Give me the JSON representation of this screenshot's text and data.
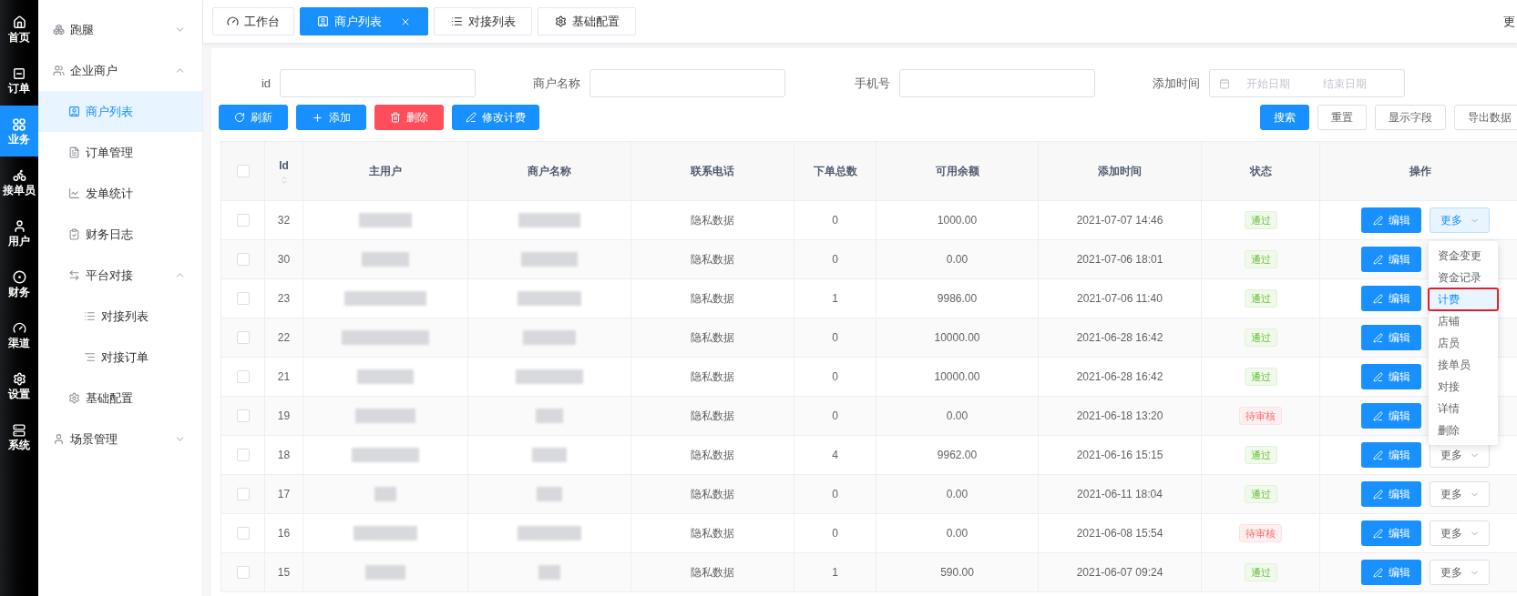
{
  "nav": [
    {
      "label": "首页",
      "selected": false
    },
    {
      "label": "订单",
      "selected": false
    },
    {
      "label": "业务",
      "selected": true
    },
    {
      "label": "接单员",
      "selected": false
    },
    {
      "label": "用户",
      "selected": false
    },
    {
      "label": "财务",
      "selected": false
    },
    {
      "label": "渠道",
      "selected": false
    },
    {
      "label": "设置",
      "selected": false
    },
    {
      "label": "系统",
      "selected": false
    }
  ],
  "submenu": [
    {
      "label": "跑腿",
      "expanded": false
    },
    {
      "label": "企业商户",
      "expanded": true,
      "children": [
        {
          "label": "商户列表",
          "selected": true
        },
        {
          "label": "订单管理",
          "selected": false
        },
        {
          "label": "发单统计",
          "selected": false
        },
        {
          "label": "财务日志",
          "selected": false
        },
        {
          "label": "平台对接",
          "expanded": true,
          "children": [
            {
              "label": "对接列表",
              "selected": false
            },
            {
              "label": "对接订单",
              "selected": false
            }
          ]
        },
        {
          "label": "基础配置",
          "selected": false
        }
      ]
    },
    {
      "label": "场景管理",
      "expanded": false
    }
  ],
  "tabs": [
    {
      "label": "工作台",
      "selected": false
    },
    {
      "label": "商户列表",
      "selected": true,
      "closable": true
    },
    {
      "label": "对接列表",
      "selected": false
    },
    {
      "label": "基础配置",
      "selected": false
    }
  ],
  "header_right_text": "更",
  "filters": [
    {
      "label": "id",
      "kind": "text"
    },
    {
      "label": "商户名称",
      "kind": "text"
    },
    {
      "label": "手机号",
      "kind": "text"
    },
    {
      "label": "添加时间",
      "kind": "daterange",
      "start_placeholder": "开始日期",
      "end_placeholder": "结束日期"
    }
  ],
  "actions": [
    {
      "label": "刷新",
      "kind": "primary"
    },
    {
      "label": "添加",
      "kind": "primary"
    },
    {
      "label": "删除",
      "kind": "danger"
    },
    {
      "label": "修改计费",
      "kind": "primary"
    }
  ],
  "search_actions": [
    {
      "label": "搜索",
      "kind": "primary"
    },
    {
      "label": "重置",
      "kind": "default"
    },
    {
      "label": "显示字段",
      "kind": "default"
    },
    {
      "label": "导出数据",
      "kind": "default"
    }
  ],
  "table": {
    "all_checked": false,
    "columns": [
      "Id",
      "主用户",
      "商户名称",
      "联系电话",
      "下单总数",
      "可用余额",
      "添加时间",
      "状态",
      "操作"
    ],
    "rows": [
      {
        "checked": false,
        "id": "32",
        "phone": "隐私数据",
        "orders": "0",
        "balance": "1000.00",
        "added": "2021-07-07 14:46",
        "status": {
          "label": "通过",
          "kind": "approved"
        },
        "edit": "编辑",
        "more": {
          "label": "更多",
          "active": true
        }
      },
      {
        "checked": false,
        "id": "30",
        "phone": "隐私数据",
        "orders": "0",
        "balance": "0.00",
        "added": "2021-07-06 18:01",
        "status": {
          "label": "通过",
          "kind": "approved"
        },
        "edit": "编辑"
      },
      {
        "checked": false,
        "id": "23",
        "phone": "隐私数据",
        "orders": "1",
        "balance": "9986.00",
        "added": "2021-07-06 11:40",
        "status": {
          "label": "通过",
          "kind": "approved"
        },
        "edit": "编辑"
      },
      {
        "checked": false,
        "id": "22",
        "phone": "隐私数据",
        "orders": "0",
        "balance": "10000.00",
        "added": "2021-06-28 16:42",
        "status": {
          "label": "通过",
          "kind": "approved"
        },
        "edit": "编辑"
      },
      {
        "checked": false,
        "id": "21",
        "phone": "隐私数据",
        "orders": "0",
        "balance": "10000.00",
        "added": "2021-06-28 16:42",
        "status": {
          "label": "通过",
          "kind": "approved"
        },
        "edit": "编辑"
      },
      {
        "checked": false,
        "id": "19",
        "phone": "隐私数据",
        "orders": "0",
        "balance": "0.00",
        "added": "2021-06-18 13:20",
        "status": {
          "label": "待审核",
          "kind": "pending"
        },
        "edit": "编辑"
      },
      {
        "checked": false,
        "id": "18",
        "phone": "隐私数据",
        "orders": "4",
        "balance": "9962.00",
        "added": "2021-06-16 15:15",
        "status": {
          "label": "通过",
          "kind": "approved"
        },
        "edit": "编辑",
        "more": {
          "label": "更多",
          "active": false
        }
      },
      {
        "checked": false,
        "id": "17",
        "phone": "隐私数据",
        "orders": "0",
        "balance": "0.00",
        "added": "2021-06-11 18:04",
        "status": {
          "label": "通过",
          "kind": "approved"
        },
        "edit": "编辑",
        "more": {
          "label": "更多",
          "active": false
        }
      },
      {
        "checked": false,
        "id": "16",
        "phone": "隐私数据",
        "orders": "0",
        "balance": "0.00",
        "added": "2021-06-08 15:54",
        "status": {
          "label": "待审核",
          "kind": "pending"
        },
        "edit": "编辑",
        "more": {
          "label": "更多",
          "active": false
        }
      },
      {
        "checked": false,
        "id": "15",
        "phone": "隐私数据",
        "orders": "1",
        "balance": "590.00",
        "added": "2021-06-07 09:24",
        "status": {
          "label": "通过",
          "kind": "approved"
        },
        "edit": "编辑",
        "more": {
          "label": "更多",
          "active": false
        }
      }
    ]
  },
  "more_menu": [
    {
      "label": "资金变更",
      "selected": false
    },
    {
      "label": "资金记录",
      "selected": false
    },
    {
      "label": "计费",
      "selected": true,
      "boxed": true
    },
    {
      "label": "店铺",
      "selected": false
    },
    {
      "label": "店员",
      "selected": false
    },
    {
      "label": "接单员",
      "selected": false
    },
    {
      "label": "对接",
      "selected": false
    },
    {
      "label": "详情",
      "selected": false
    },
    {
      "label": "删除",
      "selected": false
    }
  ]
}
